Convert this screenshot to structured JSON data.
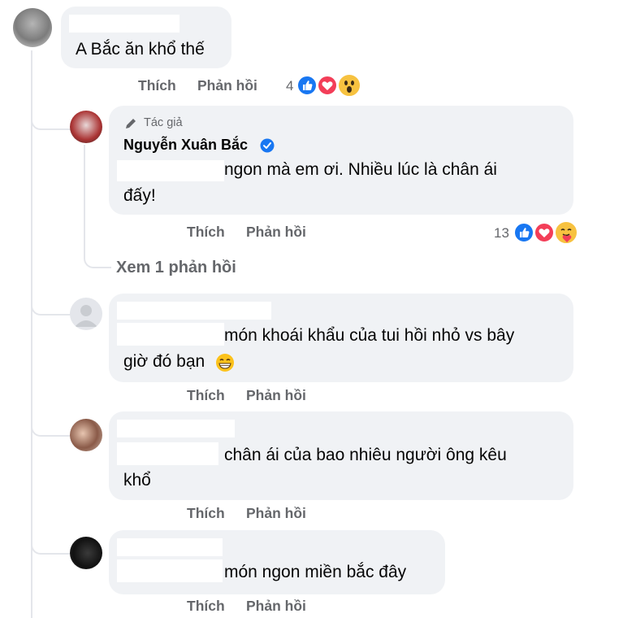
{
  "actions": {
    "like": "Thích",
    "reply": "Phản hồi"
  },
  "comments": [
    {
      "text": "A Bắc ăn khổ thế",
      "reactions_count": "4"
    },
    {
      "badge": "Tác giả",
      "author": "Nguyễn Xuân Bắc",
      "line1": "ngon mà em ơi. Nhiều lúc là chân ái",
      "line2": "đấy!",
      "reactions_count": "13",
      "view_replies": "Xem 1 phản hồi"
    },
    {
      "line1": "món khoái khẩu của tui hồi nhỏ vs bây",
      "line2": "giờ đó bạn"
    },
    {
      "line1": "chân ái của bao nhiêu người ông kêu",
      "line2": "khổ"
    },
    {
      "line1": "món ngon miền bắc đây"
    }
  ],
  "colors": {
    "like_blue": "#1877f2",
    "love_red": "#f33e58",
    "bubble_bg": "#f0f2f5",
    "action_gray": "#65676b",
    "verified_blue": "#1877f2"
  },
  "icons": [
    "like-reaction-icon",
    "love-reaction-icon",
    "wow-reaction-icon",
    "care-reaction-icon",
    "grin-emoji-icon",
    "pen-icon",
    "verified-badge-icon"
  ]
}
